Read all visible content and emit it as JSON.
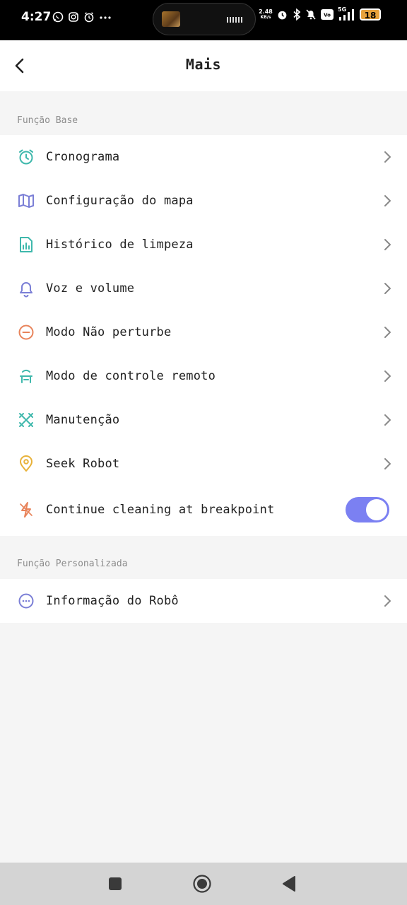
{
  "status_bar": {
    "time": "4:27",
    "speed_top": "2.48",
    "speed_unit": "KB/s",
    "network": "5G",
    "battery": "18"
  },
  "header": {
    "title": "Mais"
  },
  "sections": [
    {
      "title": "Função Base",
      "items": [
        {
          "label": "Cronograma",
          "icon": "alarm-clock-icon",
          "color": "#3fb8ac"
        },
        {
          "label": "Configuração do mapa",
          "icon": "map-icon",
          "color": "#7b7fd6"
        },
        {
          "label": "Histórico de limpeza",
          "icon": "report-icon",
          "color": "#3fb8ac"
        },
        {
          "label": "Voz e volume",
          "icon": "bell-icon",
          "color": "#7b7fd6"
        },
        {
          "label": "Modo Não perturbe",
          "icon": "minus-circle-icon",
          "color": "#e8835a"
        },
        {
          "label": "Modo de controle remoto",
          "icon": "remote-icon",
          "color": "#3fb8ac"
        },
        {
          "label": "Manutenção",
          "icon": "maintenance-icon",
          "color": "#3fb8ac"
        },
        {
          "label": "Seek Robot",
          "icon": "location-pin-icon",
          "color": "#e8b23a"
        },
        {
          "label": "Continue cleaning at breakpoint",
          "icon": "lightning-icon",
          "color": "#e8835a",
          "toggle_on": true
        }
      ]
    },
    {
      "title": "Função Personalizada",
      "items": [
        {
          "label": "Informação do Robô",
          "icon": "more-circle-icon",
          "color": "#7b7fd6"
        }
      ]
    }
  ],
  "accent_color": "#7b80f2"
}
